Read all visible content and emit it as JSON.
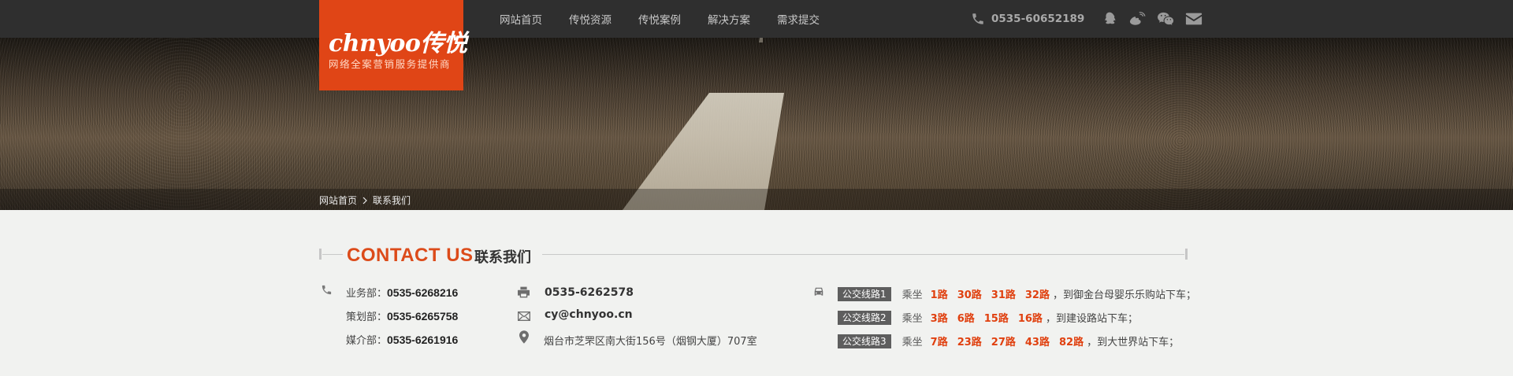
{
  "brand": {
    "logo_text": "chnyoo传悦",
    "slogan": "网络全案营销服务提供商",
    "color": "#e04516"
  },
  "nav": {
    "items": [
      "网站首页",
      "传悦资源",
      "传悦案例",
      "解决方案",
      "需求提交"
    ]
  },
  "header": {
    "phone": "0535-60652189",
    "social_icons": [
      "qq-icon",
      "weibo-icon",
      "wechat-icon",
      "mail-icon"
    ]
  },
  "breadcrumb": {
    "home": "网站首页",
    "current": "联系我们"
  },
  "section": {
    "title_en": "CONTACT US",
    "title_cn": "联系我们"
  },
  "contacts": {
    "departments": [
      {
        "label": "业务部：",
        "phone": "0535-6268216"
      },
      {
        "label": "策划部：",
        "phone": "0535-6265758"
      },
      {
        "label": "媒介部：",
        "phone": "0535-6261916"
      }
    ],
    "fax": "0535-6262578",
    "email": "cy@chnyoo.cn",
    "address": "烟台市芝罘区南大街156号（烟钢大厦）707室"
  },
  "bus": {
    "ride_label": "乘坐",
    "routes": [
      {
        "tag": "公交线路1",
        "numbers": [
          "1路",
          "30路",
          "31路",
          "32路"
        ],
        "tail": "，到御金台母婴乐乐购站下车；"
      },
      {
        "tag": "公交线路2",
        "numbers": [
          "3路",
          "6路",
          "15路",
          "16路"
        ],
        "tail": "，到建设路站下车；"
      },
      {
        "tag": "公交线路3",
        "numbers": [
          "7路",
          "23路",
          "27路",
          "43路",
          "82路"
        ],
        "tail": "，到大世界站下车；"
      }
    ]
  },
  "colors": {
    "accent": "#dc4b1a",
    "topbar": "#2f2f2f",
    "page_bg": "#f1f2f0"
  }
}
